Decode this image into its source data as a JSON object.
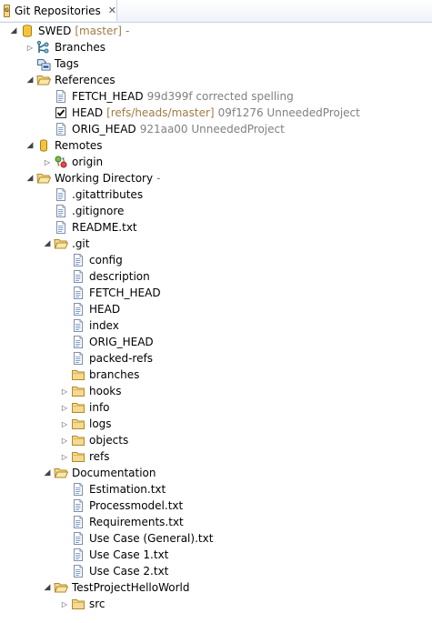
{
  "tab": {
    "title": "Git Repositories",
    "icon_text": "GIT",
    "close_symbol": "✕"
  },
  "tree": [
    {
      "depth": 0,
      "twisty": "expanded",
      "icon": "repository-icon",
      "label": "SWED",
      "decor": [
        {
          "text": "[master]",
          "style": "orange"
        },
        {
          "text": "-",
          "style": "gray"
        }
      ]
    },
    {
      "depth": 1,
      "twisty": "collapsed",
      "icon": "branches-icon",
      "label": "Branches"
    },
    {
      "depth": 1,
      "twisty": "none",
      "icon": "tags-icon",
      "label": "Tags"
    },
    {
      "depth": 1,
      "twisty": "expanded",
      "icon": "folder-open-icon",
      "label": "References"
    },
    {
      "depth": 2,
      "twisty": "none",
      "icon": "file-icon",
      "label": "FETCH_HEAD",
      "decor": [
        {
          "text": "99d399f corrected spelling",
          "style": "gray"
        }
      ]
    },
    {
      "depth": 2,
      "twisty": "none",
      "icon": "checked-ref-icon",
      "label": "HEAD",
      "decor": [
        {
          "text": "[refs/heads/master]",
          "style": "orange"
        },
        {
          "text": "09f1276 UnneededProject",
          "style": "gray"
        }
      ]
    },
    {
      "depth": 2,
      "twisty": "none",
      "icon": "file-icon",
      "label": "ORIG_HEAD",
      "decor": [
        {
          "text": "921aa00 UnneededProject",
          "style": "gray"
        }
      ]
    },
    {
      "depth": 1,
      "twisty": "expanded",
      "icon": "remotes-icon",
      "label": "Remotes"
    },
    {
      "depth": 2,
      "twisty": "collapsed",
      "icon": "remote-icon",
      "label": "origin"
    },
    {
      "depth": 1,
      "twisty": "expanded",
      "icon": "folder-open-icon",
      "label": "Working Directory",
      "decor": [
        {
          "text": "-",
          "style": "gray"
        }
      ]
    },
    {
      "depth": 2,
      "twisty": "none",
      "icon": "file-icon",
      "label": ".gitattributes"
    },
    {
      "depth": 2,
      "twisty": "none",
      "icon": "file-icon",
      "label": ".gitignore"
    },
    {
      "depth": 2,
      "twisty": "none",
      "icon": "file-icon",
      "label": "README.txt"
    },
    {
      "depth": 2,
      "twisty": "expanded",
      "icon": "folder-open-icon",
      "label": ".git"
    },
    {
      "depth": 3,
      "twisty": "none",
      "icon": "file-icon",
      "label": "config"
    },
    {
      "depth": 3,
      "twisty": "none",
      "icon": "file-icon",
      "label": "description"
    },
    {
      "depth": 3,
      "twisty": "none",
      "icon": "file-icon",
      "label": "FETCH_HEAD"
    },
    {
      "depth": 3,
      "twisty": "none",
      "icon": "file-icon",
      "label": "HEAD"
    },
    {
      "depth": 3,
      "twisty": "none",
      "icon": "file-icon",
      "label": "index"
    },
    {
      "depth": 3,
      "twisty": "none",
      "icon": "file-icon",
      "label": "ORIG_HEAD"
    },
    {
      "depth": 3,
      "twisty": "none",
      "icon": "file-icon",
      "label": "packed-refs"
    },
    {
      "depth": 3,
      "twisty": "none",
      "icon": "folder-icon",
      "label": "branches"
    },
    {
      "depth": 3,
      "twisty": "collapsed",
      "icon": "folder-icon",
      "label": "hooks"
    },
    {
      "depth": 3,
      "twisty": "collapsed",
      "icon": "folder-icon",
      "label": "info"
    },
    {
      "depth": 3,
      "twisty": "collapsed",
      "icon": "folder-icon",
      "label": "logs"
    },
    {
      "depth": 3,
      "twisty": "collapsed",
      "icon": "folder-icon",
      "label": "objects"
    },
    {
      "depth": 3,
      "twisty": "collapsed",
      "icon": "folder-icon",
      "label": "refs"
    },
    {
      "depth": 2,
      "twisty": "expanded",
      "icon": "folder-open-icon",
      "label": "Documentation"
    },
    {
      "depth": 3,
      "twisty": "none",
      "icon": "file-icon",
      "label": "Estimation.txt"
    },
    {
      "depth": 3,
      "twisty": "none",
      "icon": "file-icon",
      "label": "Processmodel.txt"
    },
    {
      "depth": 3,
      "twisty": "none",
      "icon": "file-icon",
      "label": "Requirements.txt"
    },
    {
      "depth": 3,
      "twisty": "none",
      "icon": "file-icon",
      "label": "Use Case (General).txt"
    },
    {
      "depth": 3,
      "twisty": "none",
      "icon": "file-icon",
      "label": "Use Case 1.txt"
    },
    {
      "depth": 3,
      "twisty": "none",
      "icon": "file-icon",
      "label": "Use Case 2.txt"
    },
    {
      "depth": 2,
      "twisty": "expanded",
      "icon": "folder-open-icon",
      "label": "TestProjectHelloWorld"
    },
    {
      "depth": 3,
      "twisty": "collapsed",
      "icon": "folder-icon",
      "label": "src"
    }
  ]
}
